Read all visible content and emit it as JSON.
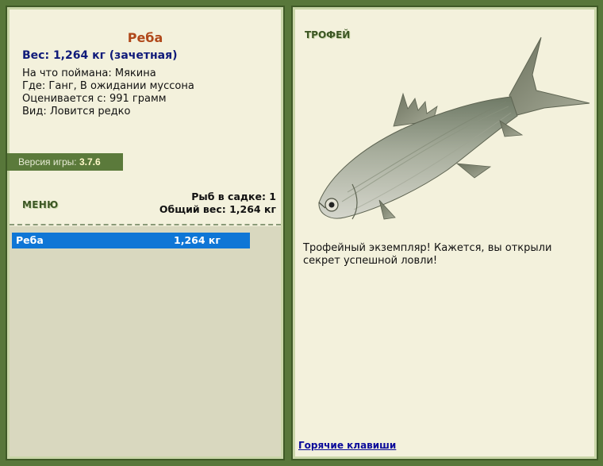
{
  "fish": {
    "name": "Реба",
    "weight": "Вес: 1,264 кг (зачетная)",
    "bait": "На что поймана: Мякина",
    "location": "Где: Ганг, В ожидании муссона",
    "value": "Оценивается с: 991 грамм",
    "rarity": "Вид: Ловится редко"
  },
  "version": {
    "label": "Версия игры:",
    "number": "3.7.6"
  },
  "menu": {
    "label": "МЕНЮ"
  },
  "cage": {
    "count": "Рыб в садке: 1",
    "total": "Общий вес: 1,264 кг"
  },
  "catch_list": [
    {
      "name": "Реба",
      "weight": "1,264 кг"
    }
  ],
  "trophy": {
    "title": "ТРОФЕЙ",
    "text": "Трофейный экземпляр! Кажется, вы открыли секрет успешной ловли!"
  },
  "hotkeys": {
    "label": "Горячие клавиши"
  },
  "colors": {
    "frame": "#58773a",
    "panel": "#f3f1dc",
    "accent_name": "#b0481a",
    "weight": "#101b7a",
    "selection": "#0f76d6"
  }
}
